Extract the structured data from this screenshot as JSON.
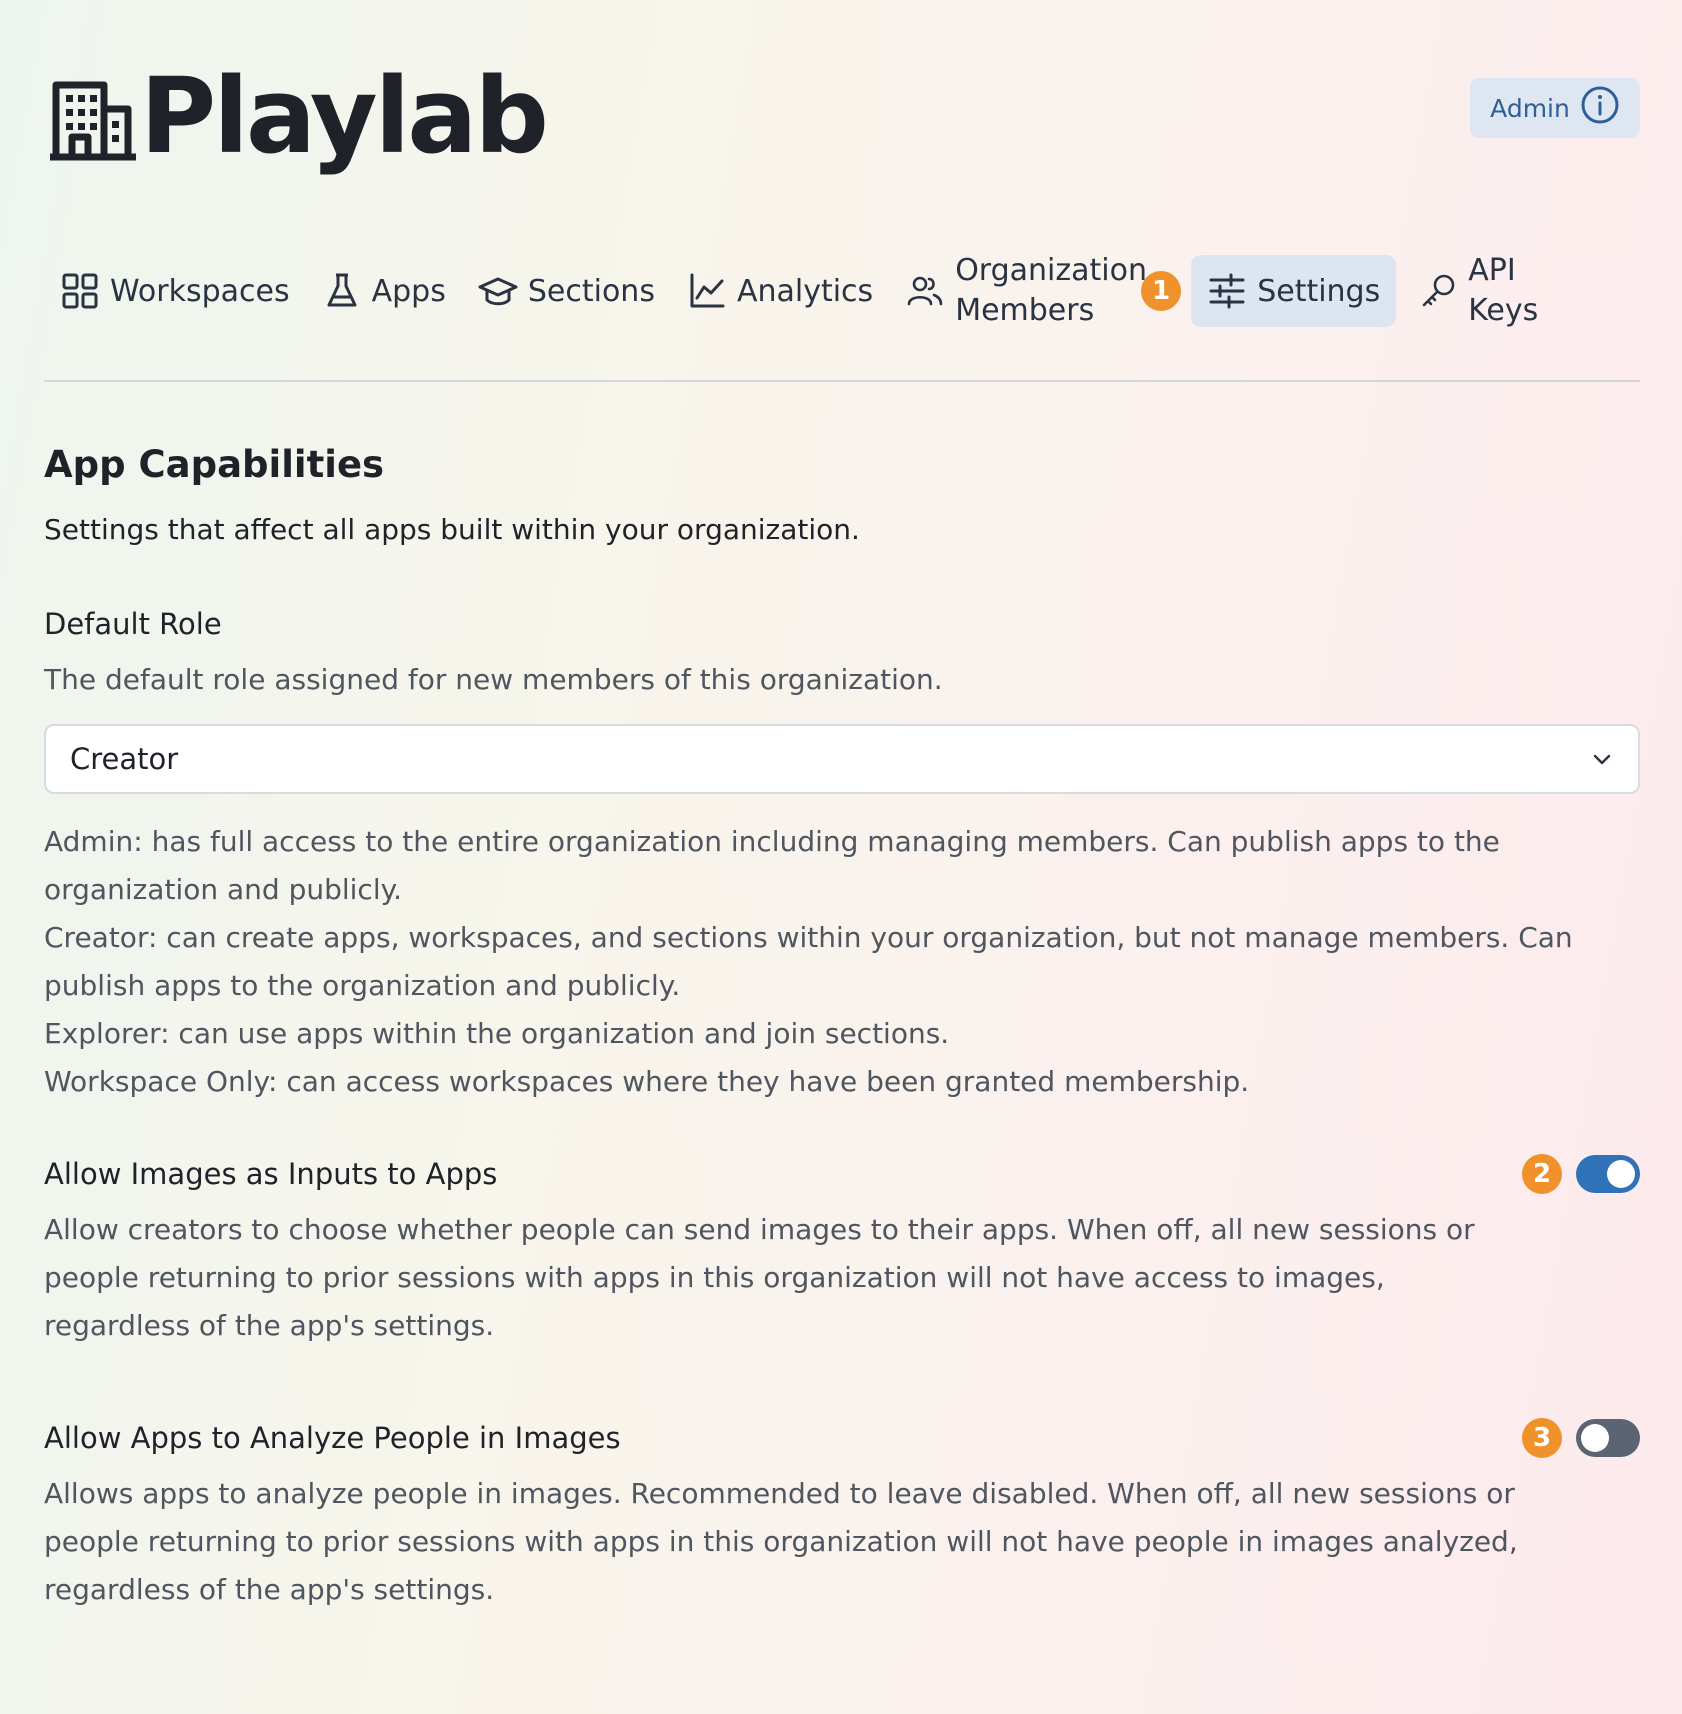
{
  "app": {
    "name": "Playlab",
    "logo_icon": "building-icon"
  },
  "header": {
    "role_badge": "Admin",
    "role_badge_icon": "info-circle-icon"
  },
  "nav": {
    "items": [
      {
        "label": "Workspaces",
        "icon": "grid-icon"
      },
      {
        "label": "Apps",
        "icon": "flask-icon"
      },
      {
        "label": "Sections",
        "icon": "graduation-cap-icon"
      },
      {
        "label": "Analytics",
        "icon": "line-chart-icon"
      },
      {
        "label": "Organization Members",
        "icon": "users-icon"
      },
      {
        "label": "Settings",
        "icon": "sliders-icon",
        "active": true
      },
      {
        "label": "API Keys",
        "icon": "key-icon"
      }
    ],
    "badge": "1"
  },
  "capabilities": {
    "title": "App Capabilities",
    "description": "Settings that affect all apps built within your organization."
  },
  "default_role": {
    "label": "Default Role",
    "description": "The default role assigned for new members of this organization.",
    "selected": "Creator",
    "roles": [
      "Admin: has full access to the entire organization including managing members. Can publish apps to the organization and publicly.",
      "Creator: can create apps, workspaces, and sections within your organization, but not manage members. Can publish apps to the organization and publicly.",
      "Explorer: can use apps within the organization and join sections.",
      "Workspace Only: can access workspaces where they have been granted membership."
    ]
  },
  "allow_images": {
    "label": "Allow Images as Inputs to Apps",
    "description": "Allow creators to choose whether people can send images to their apps. When off, all new sessions or people returning to prior sessions with apps in this organization will not have access to images, regardless of the app's settings.",
    "badge": "2",
    "enabled": true
  },
  "analyze_people": {
    "label": "Allow Apps to Analyze People in Images",
    "description": "Allows apps to analyze people in images. Recommended to leave disabled. When off, all new sessions or people returning to prior sessions with apps in this organization will not have people in images analyzed, regardless of the app's settings.",
    "badge": "3",
    "enabled": false
  },
  "colors": {
    "accent": "#2f72b8",
    "badge_orange": "#f0922b",
    "active_tab_bg": "#dce5f1"
  }
}
